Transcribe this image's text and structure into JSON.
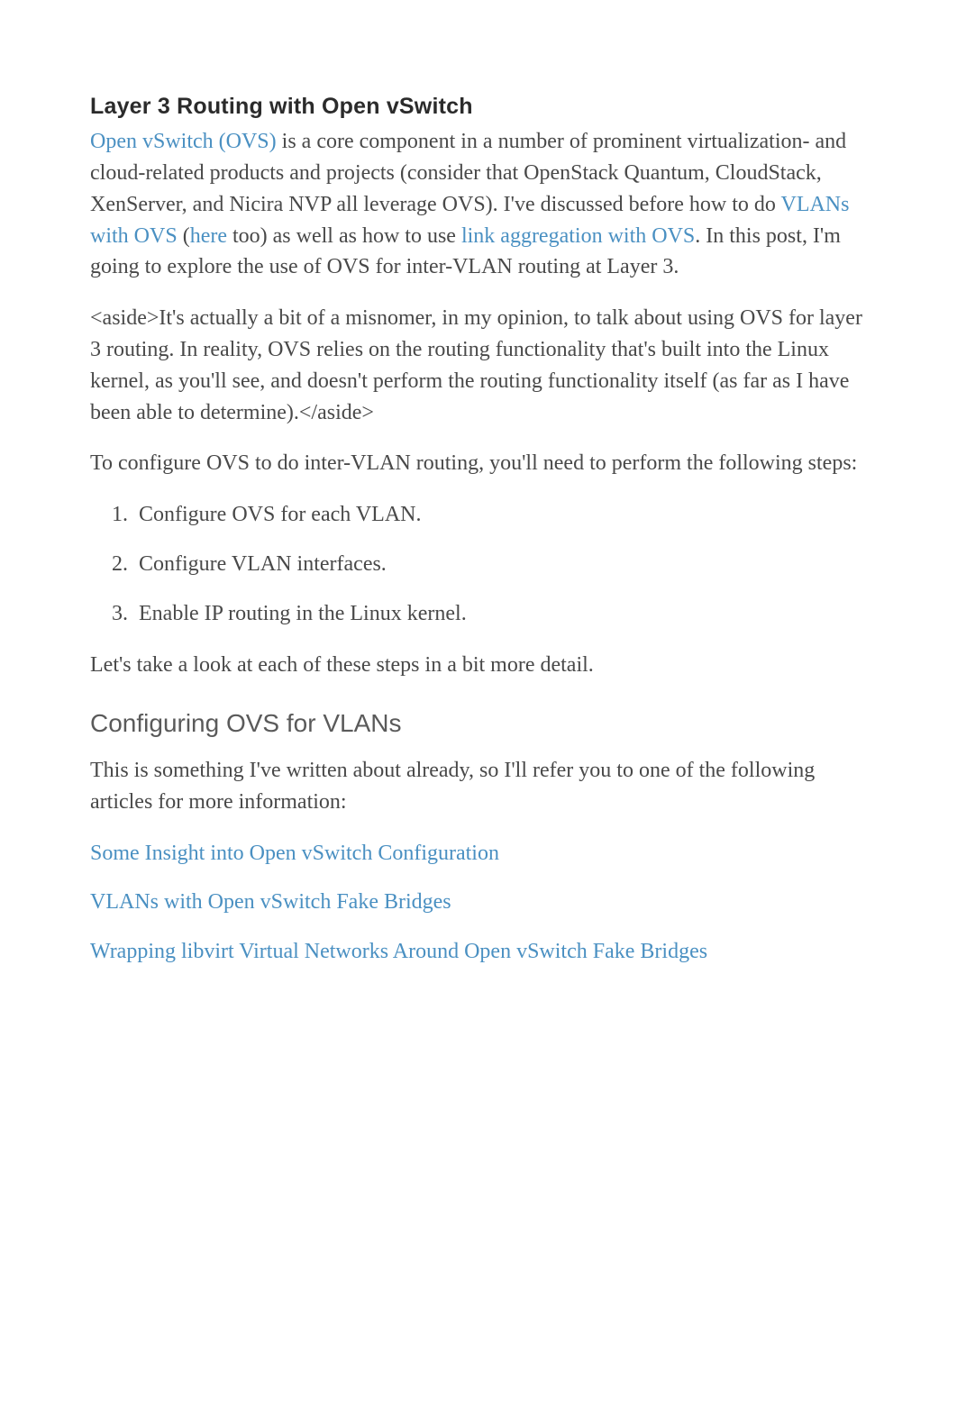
{
  "title": "Layer 3 Routing with Open vSwitch",
  "lead": {
    "link1": "Open vSwitch (OVS)",
    "text1": " is a core component in a number of prominent virtualization- and cloud-related products and projects (consider that OpenStack Quantum, CloudStack, XenServer, and Nicira NVP all leverage OVS). I've discussed before how to do ",
    "link2": "VLANs with OVS",
    "text2": " (",
    "link3": "here",
    "text3": " too) as well as how to use ",
    "link4": "link aggregation with OVS",
    "text4": ". In this post, I'm going to explore the use of OVS for inter-VLAN routing at Layer 3."
  },
  "aside": "<aside>It's actually a bit of a misnomer, in my opinion, to talk about using OVS for layer 3 routing. In reality, OVS relies on the routing functionality that's built into the Linux kernel, as you'll see, and doesn't perform the routing functionality itself (as far as I have been able to determine).</aside>",
  "intro_steps": "To configure OVS to do inter-VLAN routing, you'll need to perform the following steps:",
  "steps": [
    "Configure OVS for each VLAN.",
    "Configure VLAN interfaces.",
    "Enable IP routing in the Linux kernel."
  ],
  "closer_line": "Let's take a look at each of these steps in a bit more detail.",
  "section_heading": "Configuring OVS for VLANs",
  "section_intro": "This is something I've written about already, so I'll refer you to one of the following articles for more information:",
  "refs": [
    "Some Insight into Open vSwitch Configuration",
    "VLANs with Open vSwitch Fake Bridges",
    "Wrapping libvirt Virtual Networks Around Open vSwitch Fake Bridges"
  ]
}
